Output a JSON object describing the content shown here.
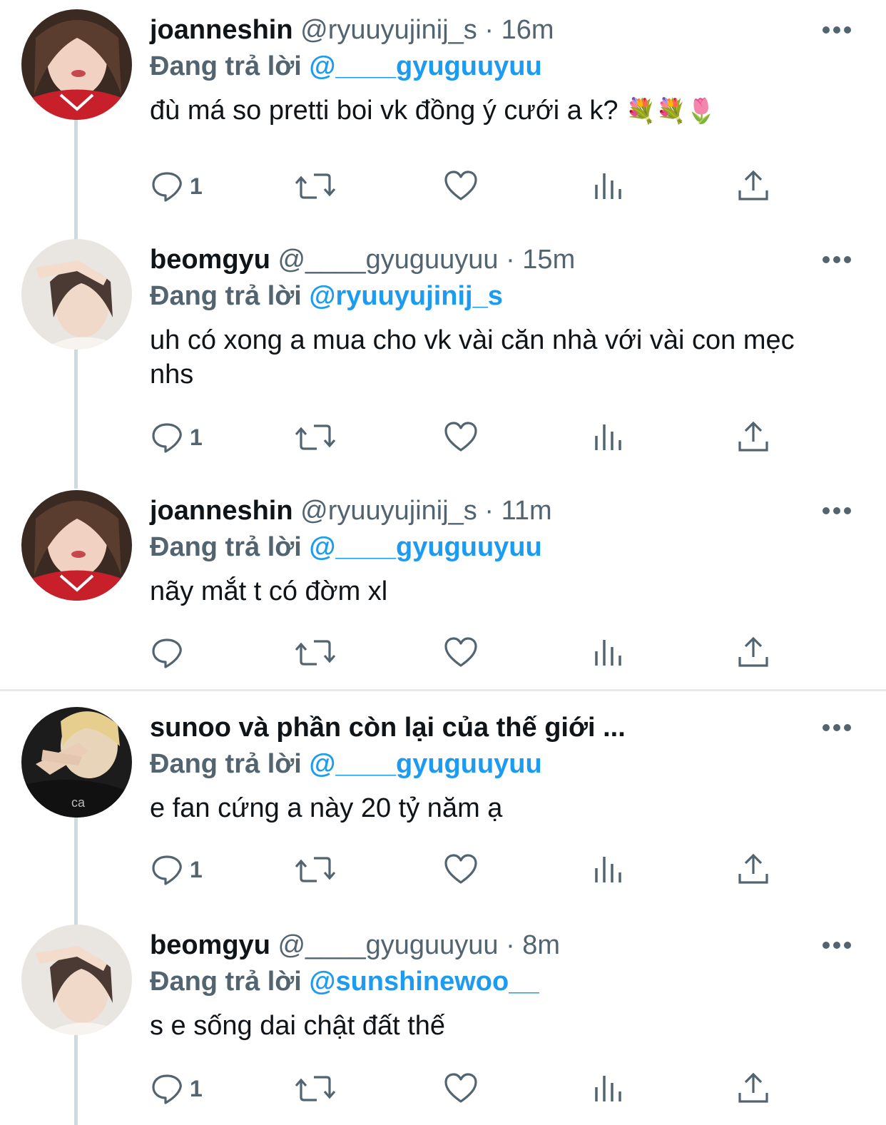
{
  "tweets": [
    {
      "name": "joanneshin",
      "handle": "@ryuuyujinij_s",
      "time": "16m",
      "reply_label": "Đang trả lời",
      "reply_to": "@____gyuguuyuu",
      "text": "đù má so pretti boi vk đồng ý cưới a k?",
      "emoji": "💐💐🌷",
      "reply_count": "1",
      "avatar": "avatar-joanneshin"
    },
    {
      "name": "beomgyu",
      "handle": "@____gyuguuyuu",
      "time": "15m",
      "reply_label": "Đang trả lời",
      "reply_to": "@ryuuyujinij_s",
      "text": "uh có xong a mua cho vk vài căn nhà với vài con mẹc nhs",
      "emoji": "",
      "reply_count": "1",
      "avatar": "avatar-beomgyu"
    },
    {
      "name": "joanneshin",
      "handle": "@ryuuyujinij_s",
      "time": "11m",
      "reply_label": "Đang trả lời",
      "reply_to": "@____gyuguuyuu",
      "text": "nãy mắt t có đờm xl",
      "emoji": "",
      "reply_count": "",
      "avatar": "avatar-joanneshin"
    },
    {
      "name": "sunoo và phần còn lại của thế giới ...",
      "handle": "",
      "time": "",
      "reply_label": "Đang trả lời",
      "reply_to": "@____gyuguuyuu",
      "text": "e fan cứng a này 20 tỷ năm ạ",
      "emoji": "",
      "reply_count": "1",
      "avatar": "avatar-sunoo"
    },
    {
      "name": "beomgyu",
      "handle": "@____gyuguuyuu",
      "time": "8m",
      "reply_label": "Đang trả lời",
      "reply_to": "@sunshinewoo__",
      "text": "s e sống dai chật đất thế",
      "emoji": "",
      "reply_count": "1",
      "avatar": "avatar-beomgyu"
    }
  ],
  "icons": {
    "reply": "speech-bubble-icon",
    "retweet": "retweet-icon",
    "like": "heart-icon",
    "views": "bar-chart-icon",
    "share": "share-upload-icon",
    "more": "more-dots-icon"
  },
  "colors": {
    "accent": "#1d9bf0",
    "muted": "#536471",
    "text": "#0f1419",
    "thread_line": "#cfd9de"
  }
}
